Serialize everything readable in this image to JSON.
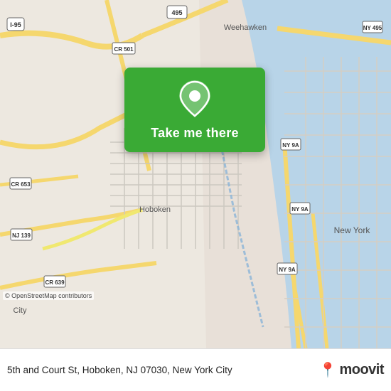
{
  "map": {
    "background_color": "#e8e0d8",
    "water_color": "#b8d4e8",
    "road_color": "#f5d76e",
    "green_area_color": "#c8e6b0"
  },
  "card": {
    "background_color": "#3aaa35",
    "button_label": "Take me there"
  },
  "bottom_bar": {
    "address": "5th and Court St, Hoboken, NJ 07030, New York City",
    "copyright": "© OpenStreetMap contributors",
    "logo_text": "moovit",
    "logo_dot": "🔴"
  },
  "pin": {
    "color": "white",
    "background": "#3aaa35"
  }
}
